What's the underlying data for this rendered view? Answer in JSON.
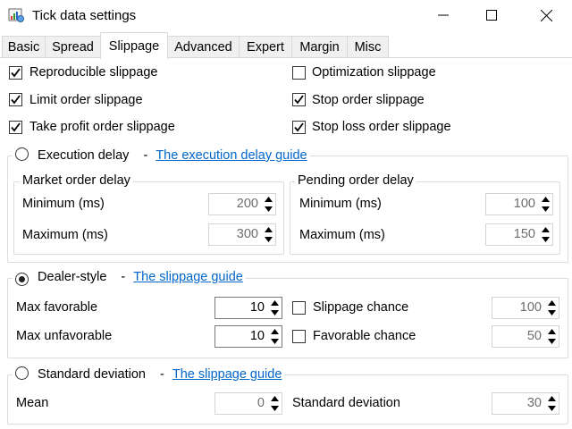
{
  "window": {
    "title": "Tick data settings"
  },
  "tabs": [
    "Basic",
    "Spread",
    "Slippage",
    "Advanced",
    "Expert",
    "Margin",
    "Misc"
  ],
  "active_tab": "Slippage",
  "checkboxes": {
    "reproducible": {
      "label": "Reproducible slippage",
      "checked": true
    },
    "optimization": {
      "label": "Optimization slippage",
      "checked": false
    },
    "limit": {
      "label": "Limit order slippage",
      "checked": true
    },
    "stop": {
      "label": "Stop order slippage",
      "checked": true
    },
    "take_profit": {
      "label": "Take profit order slippage",
      "checked": true
    },
    "stop_loss": {
      "label": "Stop loss order slippage",
      "checked": true
    }
  },
  "execution_delay": {
    "label": "Execution delay",
    "dash": "-",
    "link": "The execution delay guide",
    "selected": false,
    "market": {
      "title": "Market order delay",
      "min_label": "Minimum (ms)",
      "min_value": "200",
      "max_label": "Maximum (ms)",
      "max_value": "300"
    },
    "pending": {
      "title": "Pending order delay",
      "min_label": "Minimum (ms)",
      "min_value": "100",
      "max_label": "Maximum (ms)",
      "max_value": "150"
    }
  },
  "dealer_style": {
    "label": "Dealer-style",
    "dash": "-",
    "link": "The slippage guide",
    "selected": true,
    "max_favorable_label": "Max favorable",
    "max_favorable_value": "10",
    "max_unfavorable_label": "Max unfavorable",
    "max_unfavorable_value": "10",
    "slippage_chance_label": "Slippage chance",
    "slippage_chance_checked": false,
    "slippage_chance_value": "100",
    "favorable_chance_label": "Favorable chance",
    "favorable_chance_checked": false,
    "favorable_chance_value": "50"
  },
  "standard_deviation": {
    "label": "Standard deviation",
    "dash": "-",
    "link": "The slippage guide",
    "selected": false,
    "mean_label": "Mean",
    "mean_value": "0",
    "std_label": "Standard deviation",
    "std_value": "30"
  },
  "colors": {
    "link": "#0066cc",
    "disabled_text": "#6d6d6d",
    "border": "#dcdcdc"
  }
}
